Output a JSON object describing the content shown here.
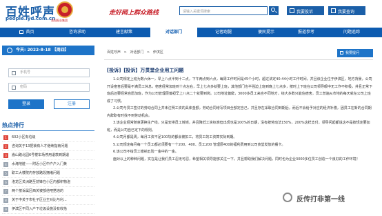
{
  "header": {
    "logo_main": "百姓呼声",
    "logo_sub": "people.lyd.com.cn",
    "logo_caption": "洛阳报业集团",
    "slogan": "走好网上群众路线",
    "search_placeholder": "请输入关键词搜索",
    "report_btn": "我要投诉",
    "query_btn": "我要查询"
  },
  "nav": {
    "items": [
      "首页",
      "咨询求助",
      "建言献策",
      "对话部门",
      "记者跑腿",
      "便民提示",
      "报道参考",
      "问题追踪"
    ],
    "active_index": 3
  },
  "left": {
    "date": "今天: 2022-8-18 【周四】",
    "username_placeholder": "手机号",
    "password_placeholder": "密码",
    "login_btn": "登录",
    "register_btn": "注册",
    "hot_title": "热点排行",
    "hot_items": [
      "602小区有垃圾",
      "咨询关于13把锁有人才继续指南问题",
      "嵩山路北园6号楼车场停用退款到期退",
      "水淹地脏——附近小区中户户入门黄",
      "职工大楼院内存放路段拥堵问题",
      "洛龙区关洲路至前锋在小区内都积物泡",
      "两个按诉属区西关被部他吧搭违的",
      "关于中关于市社子区业主对比与利...",
      "伊滨区不同入户下垃圾设施没有收拾"
    ]
  },
  "main": {
    "crumb": [
      "百姓呼声",
      ">",
      "对话部门",
      ">",
      "伊滨区"
    ],
    "post_btn": "我要提问",
    "title": "[投诉]【投诉】万贯堂企业用工问题",
    "paragraphs": [
      "1.公司规定上班为数六休一，早上八点半到十二点，下午两点到六点，每周工作时间是45个小时，超过法定40-44小时工作时间，并且该企业位于伊滨区，地方背景，公司开设宿舍后要是不满员工休息，宿舍经常加班到十点左右，早上七点多就要上班，其他部门也半强迫上班到晚上七点多，按时上下班在公司领导眼中无工作不积极，并且正常下班后还要经常自愿加班，作为公司管理层偏袒早上八点二十就要到岗。公司地址偏僻，3000多员工来自不同地方，绕大多数只能住宿舍，员工普遍从市地的每天就在公司上班成了习惯。",
      "2.公司与员工签订的劳动合同上并未注明工资的具体金额，劳动合同增写项目全部定自己，并且存在采取合同到期后，而后不会给予对应的经济补偿，因员工在新的合同期内辞职有时找不到劳动机会。",
      "3.该企业经常随意更换生产线，只是安排员工转岗，并且降低工资标准但出现也是100%的日期，没有按劳动法150%，200%这样支付，领导问起都说这不是按规定要加班，而是公司自已定下的规则。",
      "4.公司月都是周，每月工资不足100块的都会被扣工，将员工的工资算实际到期。",
      "5.公司规定每月每一个员工都必须要有一个200、400、员工200 管理层400的福利费用到公司食堂发放的餐卡。",
      "6.该公司不给员工缴纳五险一金中的一金。",
      "面对以上的种种问题，实在是让我们员工忍无可忍，希望相关领导能够关注一下，并且帮助我们解决问题，同时也为企业3000多位员工创造一个良好的工作环境！"
    ]
  },
  "watermark": "反传打非第一线"
}
